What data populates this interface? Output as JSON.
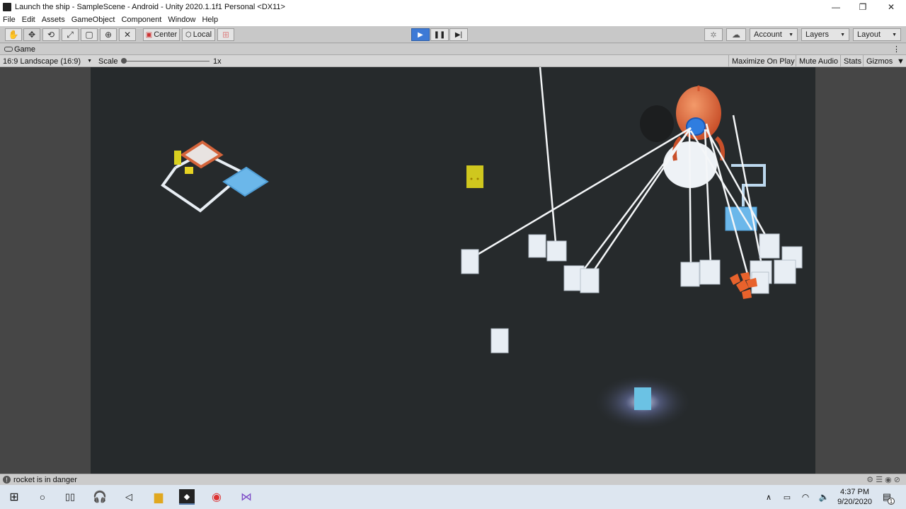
{
  "window": {
    "title": "Launch the ship - SampleScene - Android - Unity 2020.1.1f1 Personal <DX11>",
    "controls": {
      "minimize": "—",
      "restore": "❐",
      "close": "✕"
    }
  },
  "menu": [
    "File",
    "Edit",
    "Assets",
    "GameObject",
    "Component",
    "Window",
    "Help"
  ],
  "toolbar": {
    "tools": [
      "hand-icon",
      "move-icon",
      "rotate-icon",
      "scale-icon",
      "rect-icon",
      "transform-icon",
      "custom-tool-icon"
    ],
    "pivot_label": "Center",
    "space_label": "Local",
    "account_label": "Account",
    "layers_label": "Layers",
    "layout_label": "Layout",
    "dropdown_arrow": "▼"
  },
  "game_tab": {
    "label": "Game",
    "aspect": "16:9 Landscape (16:9)",
    "scale_label": "Scale",
    "scale_value": "1x",
    "maximize_label": "Maximize On Play",
    "mute_label": "Mute Audio",
    "stats_label": "Stats",
    "gizmos_label": "Gizmos"
  },
  "status": {
    "message": "rocket is in danger"
  },
  "taskbar": {
    "time": "4:37 PM",
    "date": "9/20/2020",
    "notification_count": "1"
  },
  "colors": {
    "play_active": "#3d7ad6",
    "rocket": "#e0673b",
    "cube": "#e8eef4",
    "blue_tile": "#6bb7ea",
    "yellow": "#d8d020",
    "game_bg": "#262a2c"
  }
}
